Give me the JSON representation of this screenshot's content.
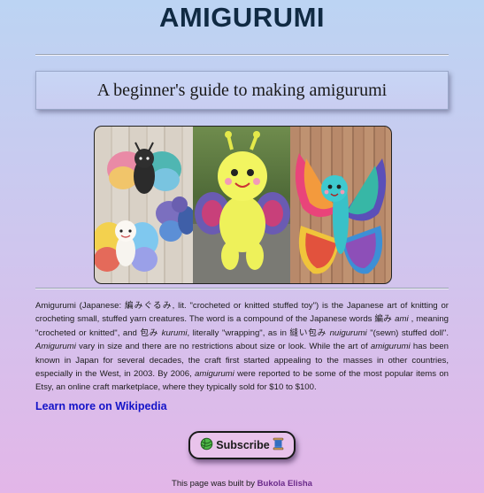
{
  "page": {
    "title": "AMIGURUMI"
  },
  "subtitle": "A beginner's guide to making amigurumi",
  "gallery": {
    "images": [
      {
        "name": "crocheted butterflies"
      },
      {
        "name": "yellow crochet butterfly doll"
      },
      {
        "name": "rainbow crochet butterfly"
      }
    ]
  },
  "article": {
    "t1": "Amigurumi (Japanese: 編みぐるみ, lit. \"crocheted or knitted stuffed toy\") is the Japanese art of knitting or crocheting small, stuffed yarn creatures. The word is a compound of the Japanese words 編み ",
    "t2": "ami",
    "t3": " , meaning \"crocheted or knitted\", and 包み ",
    "t4": "kurumi",
    "t5": ", literally \"wrapping\", as in 縫い包み ",
    "t6": "nuigurumi",
    "t7": " \"(sewn) stuffed doll\". ",
    "t8": "Amigurumi",
    "t9": " vary in size and there are no restrictions about size or look. While the art of ",
    "t10": "amigurumi",
    "t11": " has been known in Japan for several decades, the craft first started appealing to the masses in other countries, especially in the West, in 2003. By 2006, ",
    "t12": "amigurumi",
    "t13": " were reported to be some of the most popular items on Etsy, an online craft marketplace, where they typically sold for $10 to $100."
  },
  "wiki_link": "Learn more on Wikipedia",
  "subscribe": {
    "label": "Subscribe",
    "left_icon": "yarn-ball-icon",
    "right_icon": "thread-spool-icon"
  },
  "footer": {
    "text": "This page was built by ",
    "author": "Bukola Elisha",
    "author_color": "#6a2b8a"
  },
  "colors": {
    "title": "#102a43",
    "link": "#1414c8",
    "button_bg": "#e9c3eb"
  }
}
